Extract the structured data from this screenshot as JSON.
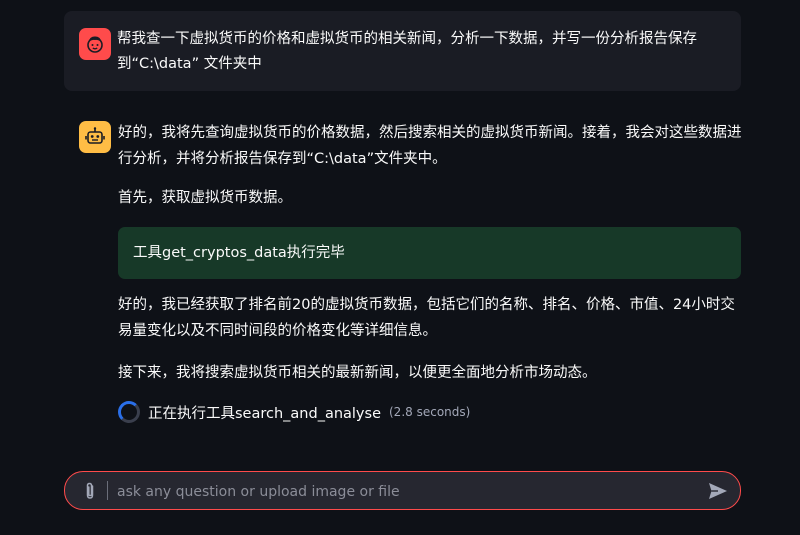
{
  "user_message": {
    "text": "帮我查一下虚拟货币的价格和虚拟货币的相关新闻，分析一下数据，并写一份分析报告保存到“C:\\data” 文件夹中",
    "avatar_icon": "user-face-icon",
    "avatar_color": "#ff4b4b"
  },
  "assistant_message": {
    "avatar_icon": "robot-icon",
    "avatar_color": "#ffbd45",
    "intro": "好的，我将先查询虚拟货币的价格数据，然后搜索相关的虚拟货币新闻。接着，我会对这些数据进行分析，并将分析报告保存到“C:\\data”文件夹中。",
    "step1": "首先，获取虚拟货币数据。",
    "tool_result": "工具get_cryptos_data执行完毕",
    "result_summary": "好的，我已经获取了排名前20的虚拟货币数据，包括它们的名称、排名、价格、市值、24小时交易量变化以及不同时间段的价格变化等详细信息。",
    "next_step": "接下来，我将搜索虚拟货币相关的最新新闻，以便更全面地分析市场动态。",
    "status": {
      "text": "正在执行工具search_and_analyse",
      "elapsed": "(2.8 seconds)"
    }
  },
  "chat_input": {
    "placeholder": "ask any question or upload image or file",
    "value": "",
    "attach_icon": "paperclip-icon",
    "send_icon": "send-icon",
    "border_color": "#ff4b4b"
  },
  "colors": {
    "background": "#0e1117",
    "user_bubble": "#1a1c24",
    "tool_box": "#173928",
    "input_bg": "#262730"
  }
}
